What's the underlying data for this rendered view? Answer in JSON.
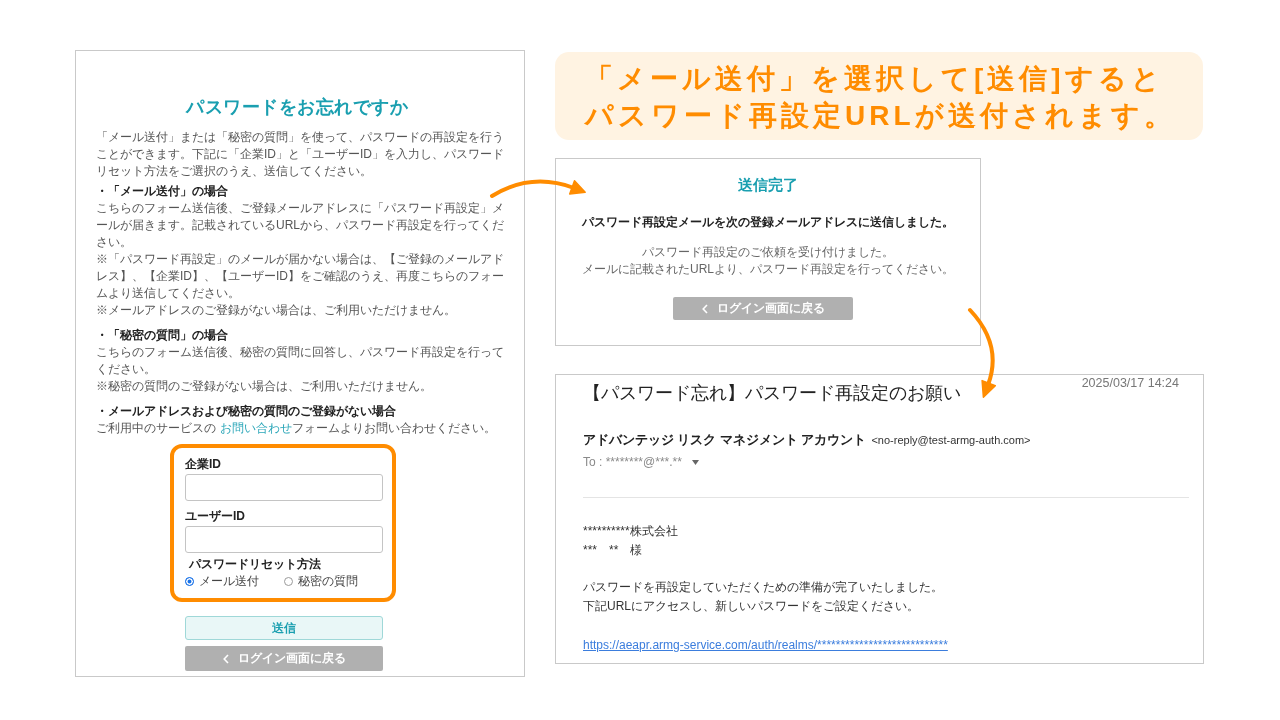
{
  "callout": {
    "lines": [
      "「メール送付」を選択して[送信]すると",
      "パスワード再設定URLが送付されます。"
    ]
  },
  "forgot_password_page": {
    "title": "パスワードをお忘れですか",
    "intro": "「メール送付」または「秘密の質問」を使って、パスワードの再設定を行うことができます。下記に「企業ID」と「ユーザーID」を入力し、パスワードリセット方法をご選択のうえ、送信してください。",
    "sections": [
      {
        "heading": "・「メール送付」の場合",
        "paragraphs": [
          "こちらのフォーム送信後、ご登録メールアドレスに「パスワード再設定」メールが届きます。記載されているURLから、パスワード再設定を行ってください。",
          "※「パスワード再設定」のメールが届かない場合は、【ご登録のメールアドレス】、【企業ID】、【ユーザーID】をご確認のうえ、再度こちらのフォームより送信してください。",
          "※メールアドレスのご登録がない場合は、ご利用いただけません。"
        ]
      },
      {
        "heading": "・「秘密の質問」の場合",
        "paragraphs": [
          "こちらのフォーム送信後、秘密の質問に回答し、パスワード再設定を行ってください。",
          "※秘密の質問のご登録がない場合は、ご利用いただけません。"
        ]
      },
      {
        "heading": "・メールアドレスおよび秘密の質問のご登録がない場合",
        "contact_note": {
          "before": "ご利用中のサービスの",
          "link": "お問い合わせ",
          "after": "フォームよりお問い合わせください。"
        }
      }
    ],
    "form": {
      "fields": [
        {
          "label": "企業ID"
        },
        {
          "label": "ユーザーID"
        }
      ],
      "reset_method": {
        "label": "パスワードリセット方法",
        "options": [
          {
            "label": "メール送付",
            "selected": true
          },
          {
            "label": "秘密の質問",
            "selected": false
          }
        ]
      }
    },
    "submit_button": "送信",
    "back_button": "ログイン画面に戻る"
  },
  "completion_page": {
    "title": "送信完了",
    "message": "パスワード再設定メールを次の登録メールアドレスに送信しました。",
    "notes": [
      "パスワード再設定のご依頼を受け付けました。",
      "メールに記載されたURLより、パスワード再設定を行ってください。"
    ],
    "back_button": "ログイン画面に戻る"
  },
  "email": {
    "subject": "【パスワード忘れ】パスワード再設定のお願い",
    "date": "2025/03/17 14:24",
    "sender_name": "アドバンテッジ リスク マネジメント アカウント",
    "sender_address": "<no-reply@test-armg-auth.com>",
    "to": "To : ********@***.**",
    "recipient": [
      "**********株式会社",
      "***　**　様"
    ],
    "message": [
      "パスワードを再設定していただくための準備が完了いたしました。",
      "下記URLにアクセスし、新しいパスワードをご設定ください。"
    ],
    "link": "https://aeapr.armg-service.com/auth/realms/****************************"
  }
}
